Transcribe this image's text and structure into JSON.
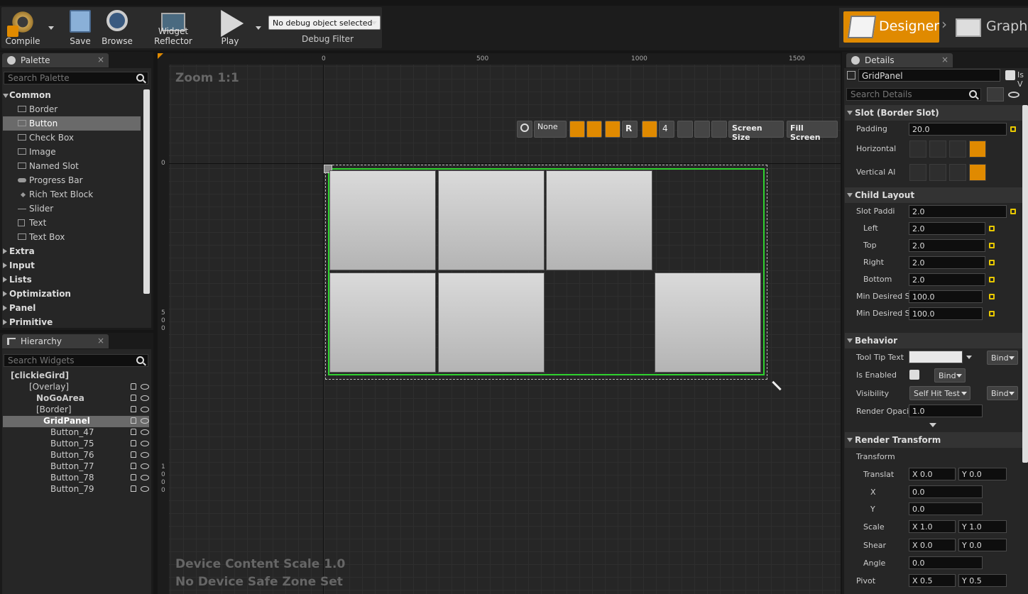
{
  "toolbar": {
    "compile": "Compile",
    "save": "Save",
    "browse": "Browse",
    "widget_reflector": "Widget Reflector",
    "play": "Play",
    "debug_select": "No debug object selected",
    "debug_filter": "Debug Filter"
  },
  "mode": {
    "designer": "Designer",
    "graph": "Graph"
  },
  "palette": {
    "tab": "Palette",
    "search_placeholder": "Search Palette",
    "common": "Common",
    "items": [
      "Border",
      "Button",
      "Check Box",
      "Image",
      "Named Slot",
      "Progress Bar",
      "Rich Text Block",
      "Slider",
      "Text",
      "Text Box"
    ],
    "categories": [
      "Extra",
      "Input",
      "Lists",
      "Optimization",
      "Panel",
      "Primitive"
    ]
  },
  "hierarchy": {
    "tab": "Hierarchy",
    "search_placeholder": "Search Widgets",
    "root": "[clickieGird]",
    "overlay": "[Overlay]",
    "nogo": "NoGoArea",
    "border": "[Border]",
    "grid": "GridPanel",
    "buttons": [
      "Button_47",
      "Button_75",
      "Button_76",
      "Button_77",
      "Button_78",
      "Button_79"
    ]
  },
  "canvas": {
    "zoom": "Zoom 1:1",
    "ruler_top": [
      "0",
      "500",
      "1000",
      "1500"
    ],
    "ruler_left_0": "0",
    "ruler_left_500": [
      "5",
      "0",
      "0"
    ],
    "ruler_left_1000": [
      "1",
      "0",
      "0",
      "0"
    ],
    "none": "None",
    "r": "R",
    "grid_num": "4",
    "screen_size": "Screen Size",
    "fill_screen": "Fill Screen",
    "device_scale": "Device Content Scale 1.0",
    "safe_zone": "No Device Safe Zone Set"
  },
  "details": {
    "tab": "Details",
    "name": "GridPanel",
    "is_variable": "Is V",
    "search_placeholder": "Search Details",
    "slot_section": "Slot (Border Slot)",
    "padding_label": "Padding",
    "padding_value": "20.0",
    "horizontal_label": "Horizontal",
    "vertical_label": "Vertical Al",
    "child_layout": "Child Layout",
    "slot_padding_label": "Slot Paddi",
    "slot_padding_value": "2.0",
    "left_label": "Left",
    "left_value": "2.0",
    "top_label": "Top",
    "top_value": "2.0",
    "right_label": "Right",
    "right_value": "2.0",
    "bottom_label": "Bottom",
    "bottom_value": "2.0",
    "min_desired_1": "Min Desired S",
    "min_desired_1_value": "100.0",
    "min_desired_2": "Min Desired S",
    "min_desired_2_value": "100.0",
    "behavior": "Behavior",
    "tooltip_label": "Tool Tip Text",
    "bind": "Bind",
    "enabled_label": "Is Enabled",
    "visibility_label": "Visibility",
    "visibility_value": "Self Hit Test",
    "opacity_label": "Render Opacit",
    "opacity_value": "1.0",
    "render_transform": "Render Transform",
    "transform_label": "Transform",
    "translation_label": "Translat",
    "tx": "0.0",
    "ty": "0.0",
    "x_label": "X",
    "x_value": "0.0",
    "y_label": "Y",
    "y_value": "0.0",
    "scale_label": "Scale",
    "sx": "1.0",
    "sy": "1.0",
    "shear_label": "Shear",
    "shx": "0.0",
    "shy": "0.0",
    "angle_label": "Angle",
    "angle_value": "0.0",
    "pivot_label": "Pivot",
    "px": "0.5",
    "py": "0.5",
    "xl": "X",
    "yl": "Y"
  }
}
